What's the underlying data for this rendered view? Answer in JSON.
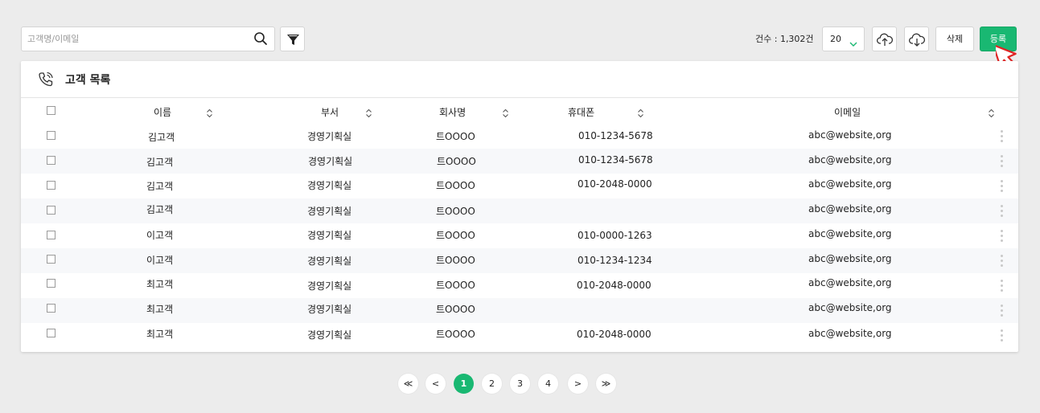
{
  "search": {
    "placeholder": "고객명/이메일",
    "value": ""
  },
  "toolbar": {
    "count_label": "건수 : 1,302건",
    "page_size": "20",
    "delete_label": "삭제",
    "register_label": "등록"
  },
  "card": {
    "title": "고객 목록"
  },
  "table": {
    "headers": {
      "name": "이름",
      "dept": "부서",
      "company": "회사명",
      "phone": "휴대폰",
      "email": "이메일"
    },
    "rows": [
      {
        "name": "김고객",
        "dept": "경영기획실",
        "company": "트OOOO",
        "phone": "010-1234-5678",
        "email": "abc@website,org"
      },
      {
        "name": "김고객",
        "dept": "경영기획실",
        "company": "트OOOO",
        "phone": "010-1234-5678",
        "email": "abc@website,org"
      },
      {
        "name": "김고객",
        "dept": "경영기획실",
        "company": "트OOOO",
        "phone": "010-2048-0000",
        "email": "abc@website,org"
      },
      {
        "name": "김고객",
        "dept": "경영기획실",
        "company": "트OOOO",
        "phone": "",
        "email": "abc@website,org"
      },
      {
        "name": "이고객",
        "dept": "경영기획실",
        "company": "트OOOO",
        "phone": "010-0000-1263",
        "email": "abc@website,org"
      },
      {
        "name": "이고객",
        "dept": "경영기획실",
        "company": "트OOOO",
        "phone": "010-1234-1234",
        "email": "abc@website,org"
      },
      {
        "name": "최고객",
        "dept": "경영기획실",
        "company": "트OOOO",
        "phone": "010-2048-0000",
        "email": "abc@website,org"
      },
      {
        "name": "최고객",
        "dept": "경영기획실",
        "company": "트OOOO",
        "phone": "",
        "email": "abc@website,org"
      },
      {
        "name": "최고객",
        "dept": "경영기획실",
        "company": "트OOOO",
        "phone": "010-2048-0000",
        "email": "abc@website,org"
      }
    ]
  },
  "pagination": {
    "first": "≪",
    "prev": "<",
    "next": ">",
    "last": "≫",
    "pages": [
      "1",
      "2",
      "3",
      "4"
    ],
    "current": "1"
  },
  "colors": {
    "accent": "#19b872",
    "background": "#ececec"
  },
  "icons": [
    "search-icon",
    "filter-icon",
    "chevron-down-icon",
    "upload-cloud-icon",
    "download-cloud-icon",
    "phone-icon",
    "sort-icon",
    "kebab-icon",
    "cursor-icon"
  ]
}
